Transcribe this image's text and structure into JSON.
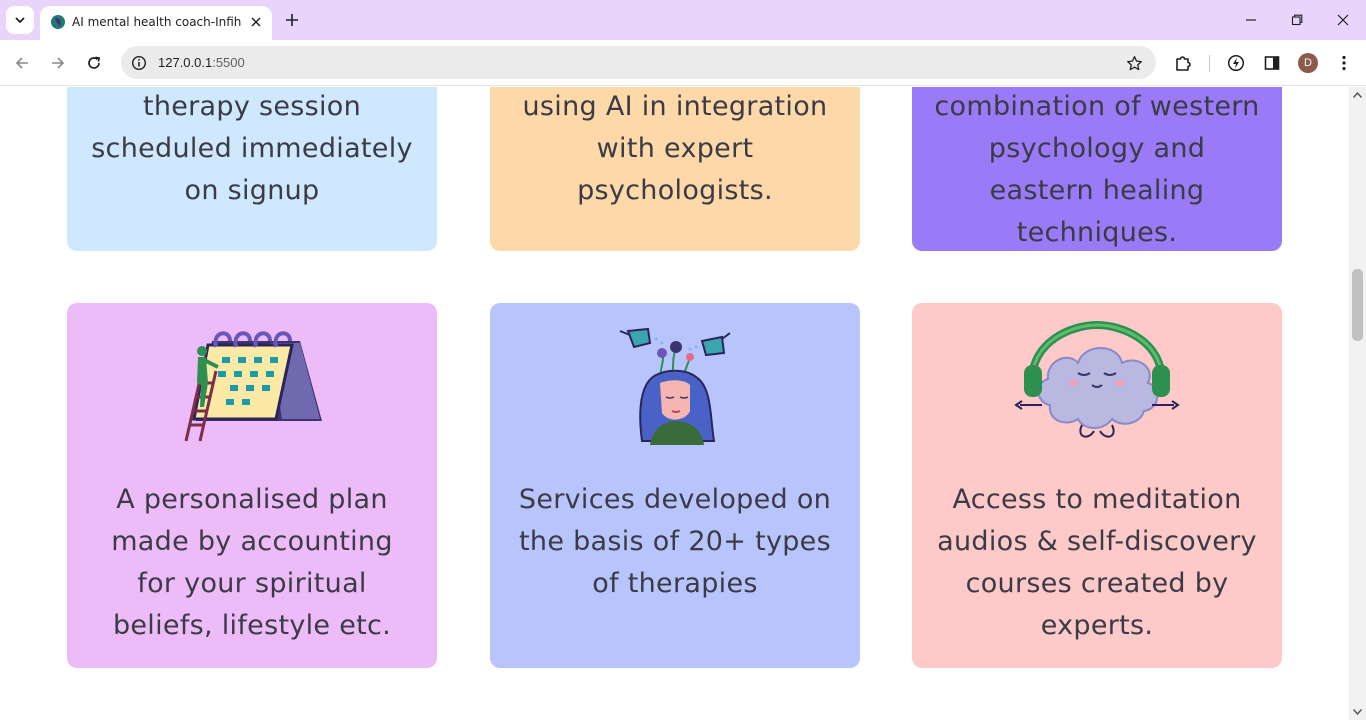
{
  "browser": {
    "tab_title": "AI mental health coach-Infiheal",
    "url_host": "127.0.0.1",
    "url_port": ":5500",
    "profile_initial": "D"
  },
  "cards_top": [
    {
      "lines": [
        "therapy session",
        "scheduled immediately",
        "on signup"
      ],
      "bg": "#cfe8fd"
    },
    {
      "lines": [
        "using AI in integration",
        "with expert",
        "psychologists."
      ],
      "bg": "#fdd8a8"
    },
    {
      "lines": [
        "combination of western",
        "psychology and",
        "eastern healing",
        "techniques."
      ],
      "bg": "#9a7af6"
    }
  ],
  "cards_bottom": [
    {
      "lines": [
        "A personalised plan",
        "made by accounting",
        "for your spiritual",
        "beliefs, lifestyle etc."
      ],
      "bg": "#edbcf8",
      "icon": "calendar-illustration-icon"
    },
    {
      "lines": [
        "Services developed on",
        "the basis of 20+ types",
        "of therapies"
      ],
      "bg": "#b8c5fd",
      "icon": "growing-mind-illustration-icon"
    },
    {
      "lines": [
        "Access to meditation",
        "audios & self-discovery",
        "courses created by",
        "experts."
      ],
      "bg": "#fdc9c9",
      "icon": "meditating-cloud-illustration-icon"
    }
  ]
}
